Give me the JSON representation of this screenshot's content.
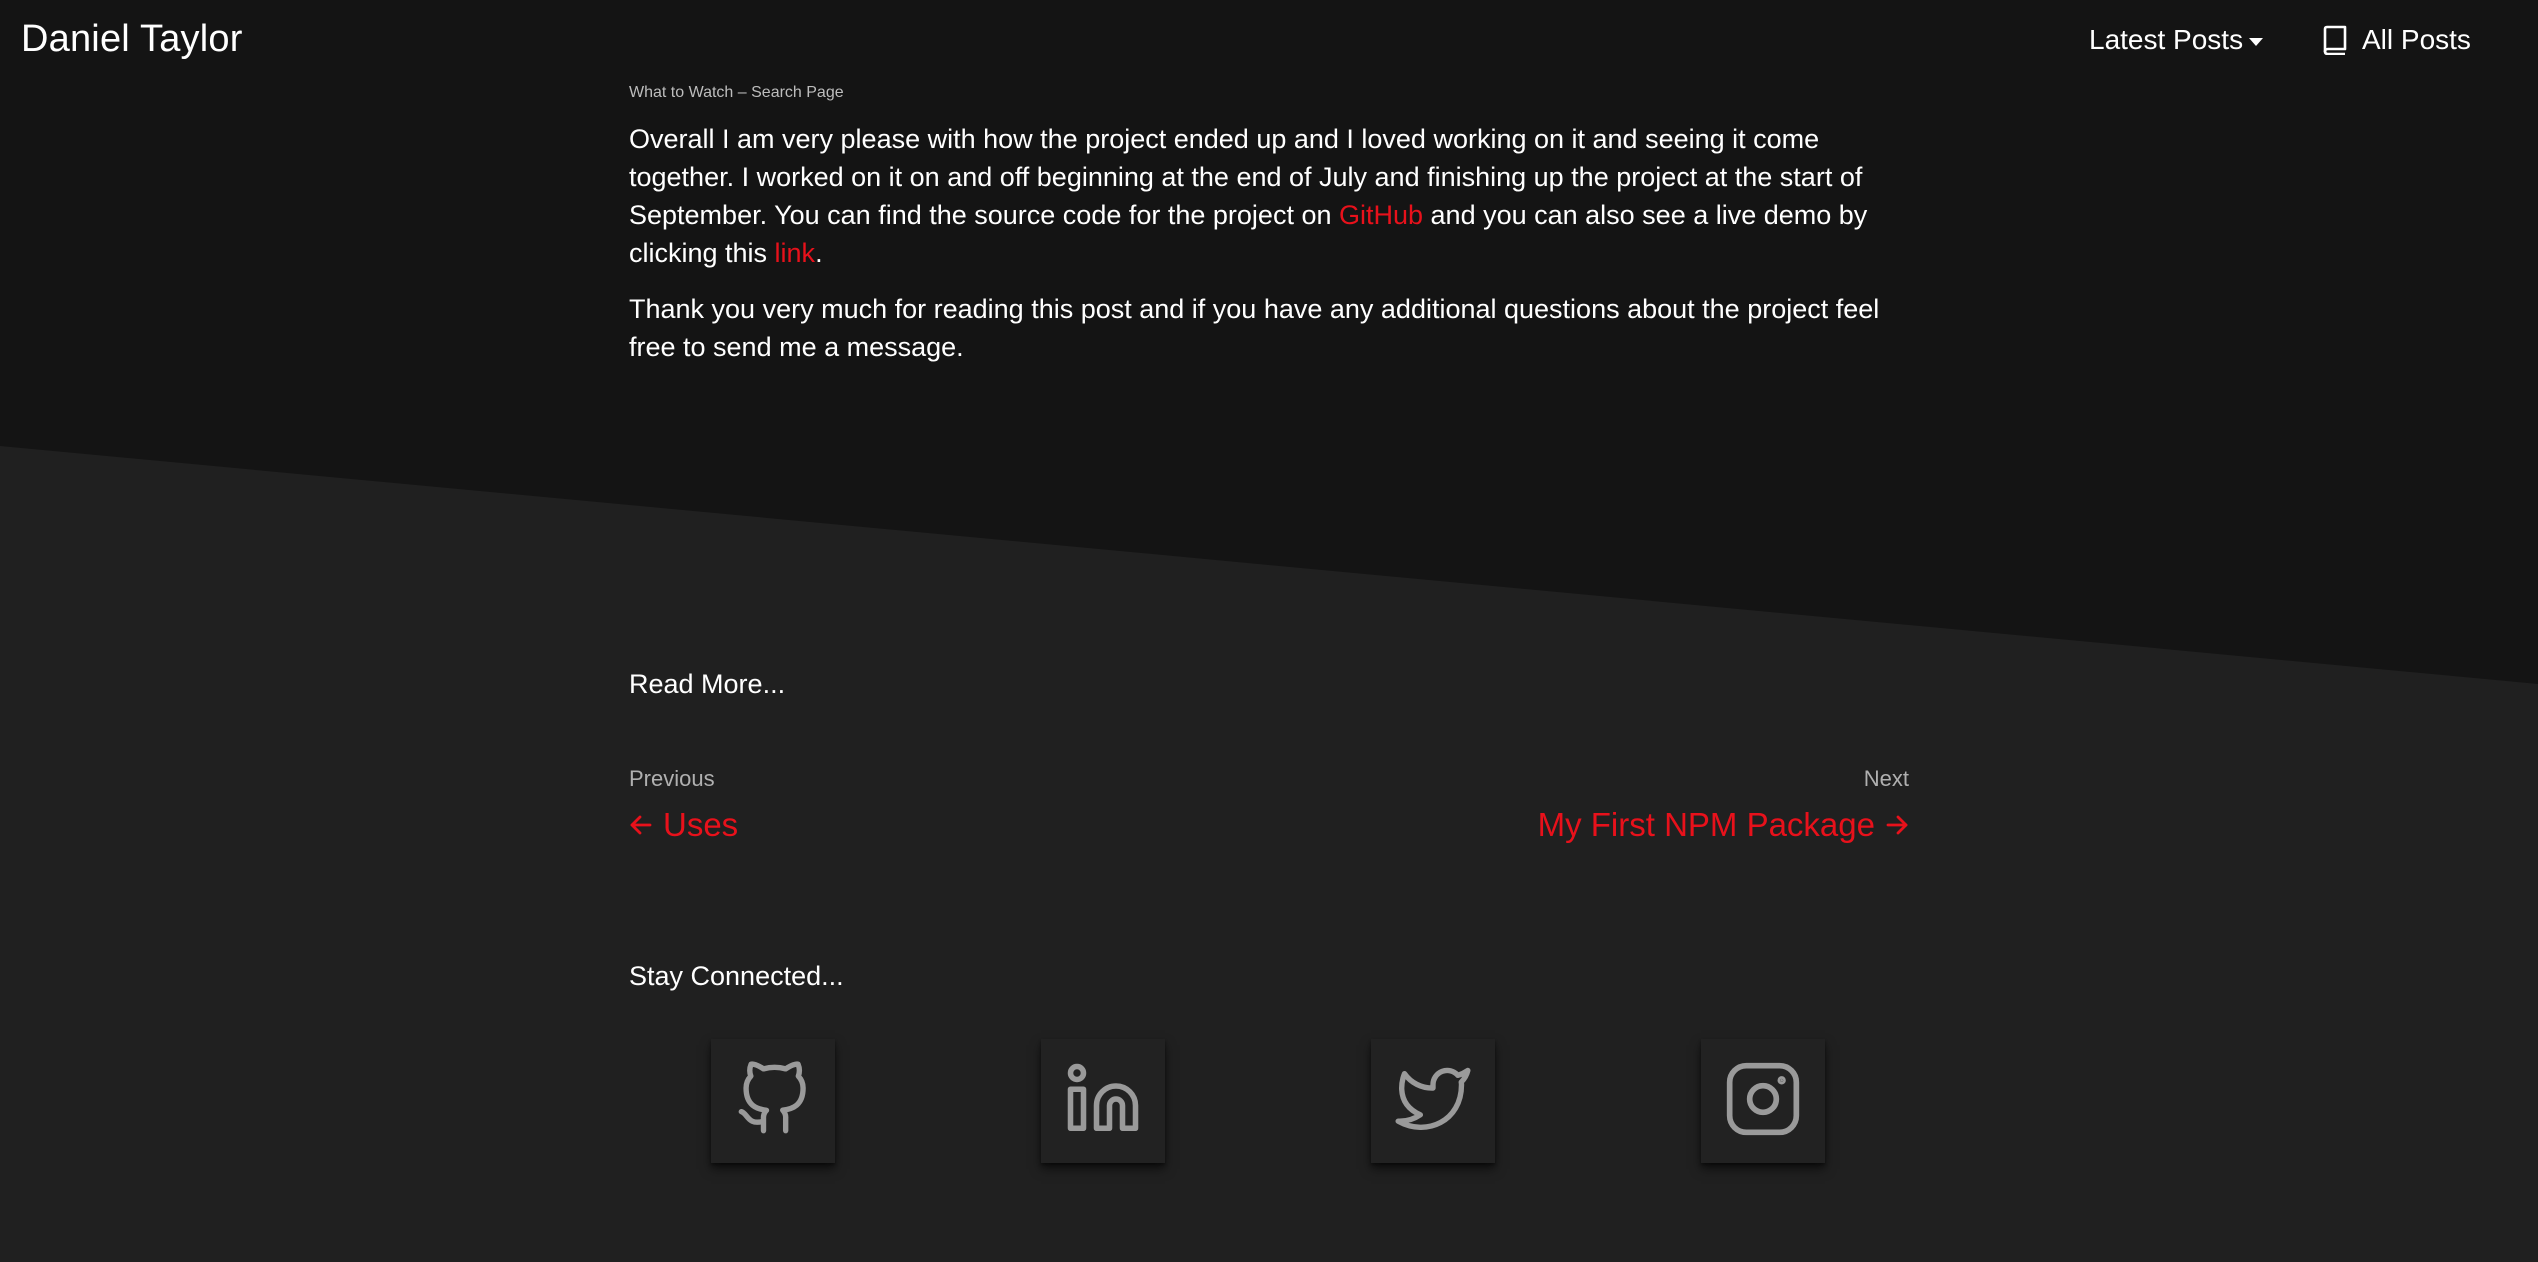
{
  "colors": {
    "accent": "#e8111b",
    "header_background": "#141414",
    "page_background": "#202020",
    "text": "#ffffff",
    "muted_text": "#b0b0b0",
    "icon": "#9a9a9a"
  },
  "navbar": {
    "brand": "Daniel Taylor",
    "latest_posts": "Latest Posts",
    "latest_posts_icon": "caret-down-icon",
    "all_posts": "All Posts",
    "all_posts_icon": "book-icon"
  },
  "article": {
    "image_caption": "What to Watch – Search Page",
    "paragraph1": {
      "text_before_github": "Overall I am very please with how the project ended up and I loved working on it and seeing it come together. I worked on it on and off beginning at the end of July and finishing up the project at the start of September. You can find the source code for the project on ",
      "github_link": "GitHub",
      "text_between": " and you can also see a live demo by clicking this ",
      "demo_link": "link",
      "text_end": "."
    },
    "paragraph2": "Thank you very much for reading this post and if you have any additional questions about the project feel free to send me a message."
  },
  "read_more": {
    "heading": "Read More...",
    "previous": {
      "label": "Previous",
      "title": "Uses",
      "icon": "arrow-left-icon"
    },
    "next": {
      "label": "Next",
      "title": "My First NPM Package",
      "icon": "arrow-right-icon"
    }
  },
  "social": {
    "heading": "Stay Connected...",
    "items": [
      {
        "icon": "github-icon"
      },
      {
        "icon": "linkedin-icon"
      },
      {
        "icon": "twitter-icon"
      },
      {
        "icon": "instagram-icon"
      }
    ]
  }
}
